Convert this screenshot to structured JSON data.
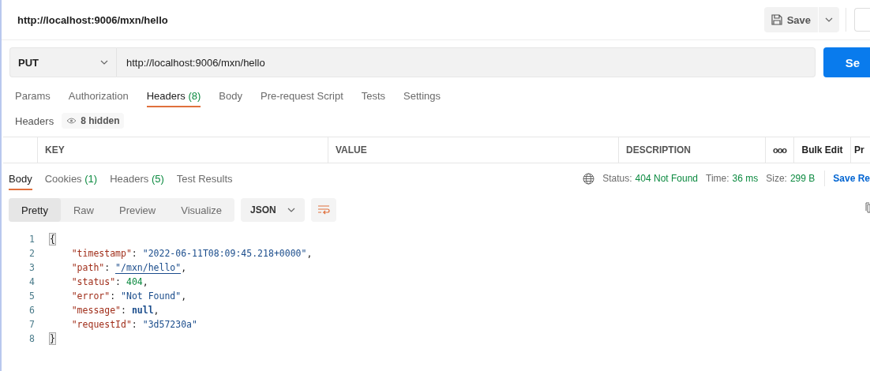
{
  "request_title": "http://localhost:9006/mxn/hello",
  "save_button": "Save",
  "method": "PUT",
  "url": "http://localhost:9006/mxn/hello",
  "send_button": "Se",
  "request_tabs": [
    {
      "label": "Params",
      "selected": false
    },
    {
      "label": "Authorization",
      "selected": false
    },
    {
      "label": "Headers",
      "count": "(8)",
      "selected": true
    },
    {
      "label": "Body",
      "selected": false
    },
    {
      "label": "Pre-request Script",
      "selected": false
    },
    {
      "label": "Tests",
      "selected": false
    },
    {
      "label": "Settings",
      "selected": false
    }
  ],
  "headers_label": "Headers",
  "hidden_toggle": "8 hidden",
  "table": {
    "columns": [
      "KEY",
      "VALUE",
      "DESCRIPTION"
    ],
    "more": "ooo",
    "bulk_edit": "Bulk Edit",
    "cut_column": "Pr"
  },
  "response_tabs": [
    {
      "label": "Body",
      "selected": true
    },
    {
      "label": "Cookies",
      "count": "(1)",
      "selected": false
    },
    {
      "label": "Headers",
      "count": "(5)",
      "selected": false
    },
    {
      "label": "Test Results",
      "selected": false
    }
  ],
  "response_meta": [
    {
      "label": "Status:",
      "value": "404 Not Found"
    },
    {
      "label": "Time:",
      "value": "36 ms"
    },
    {
      "label": "Size:",
      "value": "299 B"
    }
  ],
  "save_response": "Save Re",
  "view_modes": [
    {
      "label": "Pretty",
      "selected": true
    },
    {
      "label": "Raw",
      "selected": false
    },
    {
      "label": "Preview",
      "selected": false
    },
    {
      "label": "Visualize",
      "selected": false
    }
  ],
  "format": "JSON",
  "code_lines": [
    {
      "number": "1",
      "tokens": [
        {
          "kind": "brace",
          "text": "{"
        }
      ]
    },
    {
      "number": "2",
      "tokens": [
        {
          "kind": "key",
          "text": "    \"timestamp\""
        },
        {
          "kind": "punct",
          "text": ": "
        },
        {
          "kind": "string",
          "text": "\"2022-06-11T08:09:45.218+0000\""
        },
        {
          "kind": "punct",
          "text": ","
        }
      ]
    },
    {
      "number": "3",
      "tokens": [
        {
          "kind": "key",
          "text": "    \"path\""
        },
        {
          "kind": "punct",
          "text": ": "
        },
        {
          "kind": "link",
          "text": "\"/mxn/hello\""
        },
        {
          "kind": "punct",
          "text": ","
        }
      ]
    },
    {
      "number": "4",
      "tokens": [
        {
          "kind": "key",
          "text": "    \"status\""
        },
        {
          "kind": "punct",
          "text": ": "
        },
        {
          "kind": "number",
          "text": "404"
        },
        {
          "kind": "punct",
          "text": ","
        }
      ]
    },
    {
      "number": "5",
      "tokens": [
        {
          "kind": "key",
          "text": "    \"error\""
        },
        {
          "kind": "punct",
          "text": ": "
        },
        {
          "kind": "string",
          "text": "\"Not Found\""
        },
        {
          "kind": "punct",
          "text": ","
        }
      ]
    },
    {
      "number": "6",
      "tokens": [
        {
          "kind": "key",
          "text": "    \"message\""
        },
        {
          "kind": "punct",
          "text": ": "
        },
        {
          "kind": "keyword",
          "text": "null"
        },
        {
          "kind": "punct",
          "text": ","
        }
      ]
    },
    {
      "number": "7",
      "tokens": [
        {
          "kind": "key",
          "text": "    \"requestId\""
        },
        {
          "kind": "punct",
          "text": ": "
        },
        {
          "kind": "string",
          "text": "\"3d57230a\""
        }
      ]
    },
    {
      "number": "8",
      "tokens": [
        {
          "kind": "brace",
          "text": "}"
        }
      ]
    }
  ]
}
